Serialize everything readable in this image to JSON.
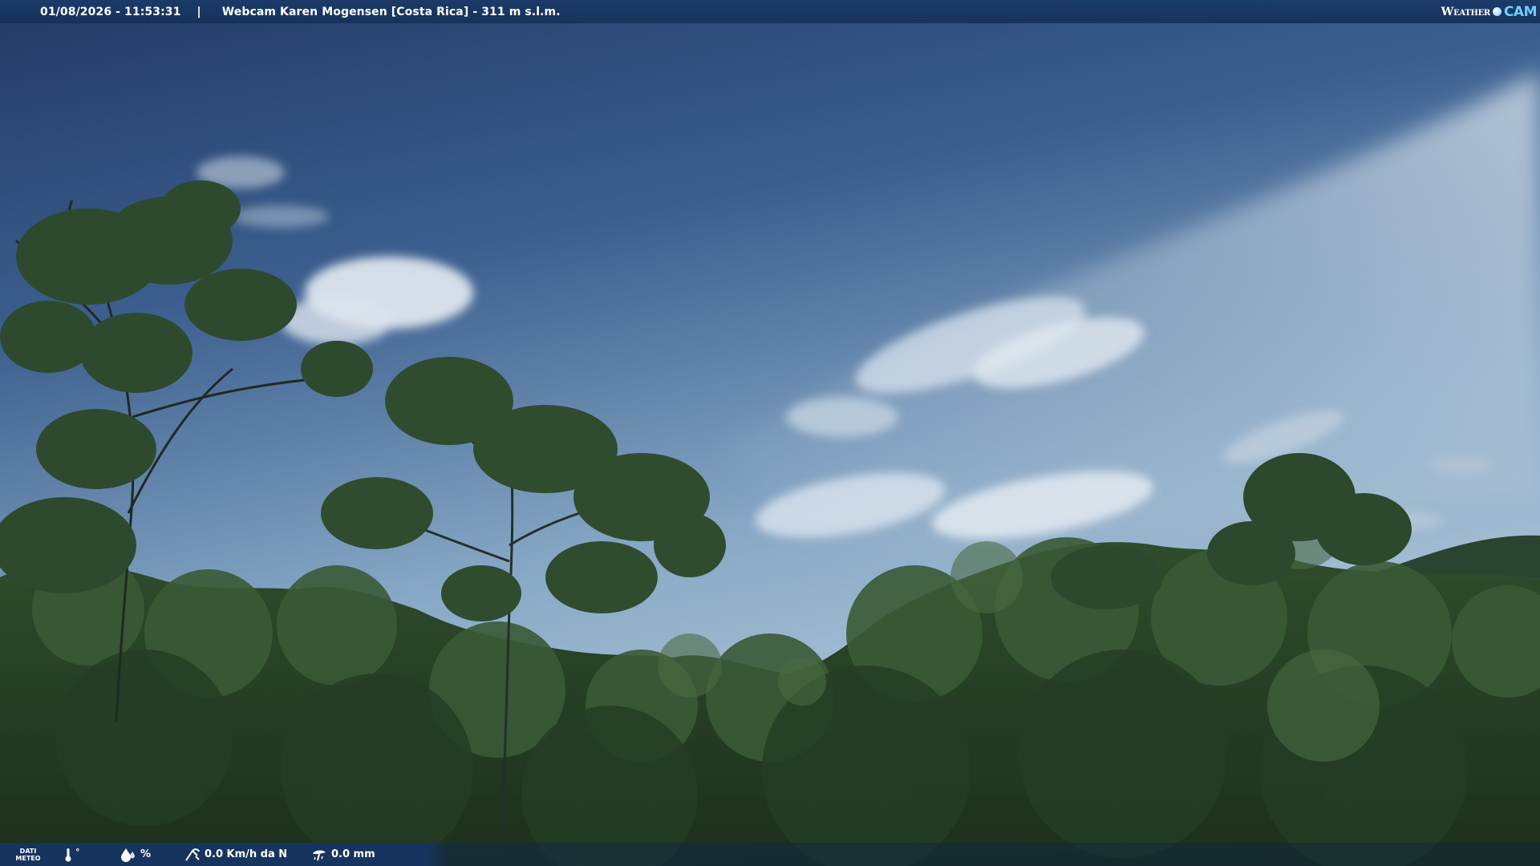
{
  "header": {
    "datetime": "01/08/2026 - 11:53:31",
    "separator": "|",
    "title": "Webcam Karen Mogensen [Costa Rica] - 311 m s.l.m."
  },
  "brand": {
    "word1": "Weather",
    "word2": "CAM"
  },
  "weather_bar": {
    "label_line1": "DATI",
    "label_line2": "METEO",
    "temperature_unit": "°",
    "humidity_unit": "%",
    "wind": "0.0 Km/h da N",
    "rain": "0.0 mm",
    "icons": [
      "thermometer-icon",
      "humidity-drop-icon",
      "wind-icon",
      "rain-icon"
    ]
  },
  "colors": {
    "bar_blue": "#1a3a68",
    "brand_cyan": "#6fd0ff",
    "sky_top": "#263f6c",
    "sky_horizon": "#b9cfe0",
    "foliage": "#2c4a2a"
  }
}
